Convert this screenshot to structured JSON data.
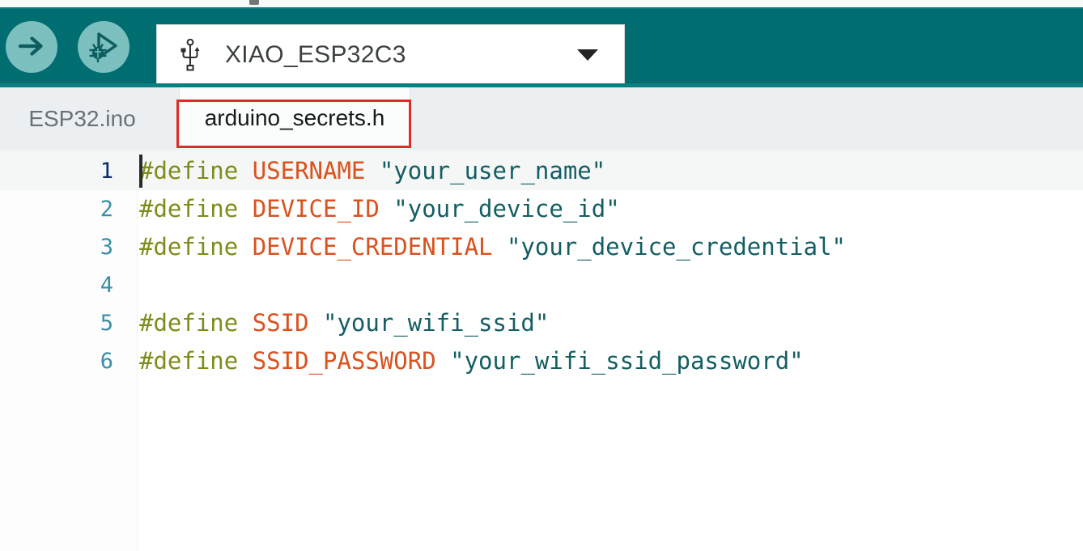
{
  "window": {
    "background_color": "#ffffff",
    "toolbar_color": "#006d70",
    "accent_color": "#7bbfbf",
    "annotation_color": "#e02b26"
  },
  "toolbar": {
    "upload_button": {
      "label": "Upload",
      "icon": "arrow-right-icon"
    },
    "debug_button": {
      "label": "Start Debugging",
      "icon": "debug-bug-play-icon"
    },
    "board_selector": {
      "icon": "usb-icon",
      "value": "XIAO_ESP32C3",
      "caret_icon": "chevron-down-icon",
      "options": [
        "XIAO_ESP32C3"
      ]
    }
  },
  "tabs": [
    {
      "label": "ESP32.ino",
      "active": false
    },
    {
      "label": "arduino_secrets.h",
      "active": true,
      "highlighted": true
    }
  ],
  "editor": {
    "language": "c",
    "cursor_line": 1,
    "cursor_column": 1,
    "colors": {
      "directive": "#7f8c1a",
      "macro": "#d9531e",
      "string": "#135e62",
      "line_number": "#3a8fa5",
      "line_number_active": "#0d2a66",
      "active_line_bg": "#f5f6f6"
    },
    "lines": [
      {
        "number": "1",
        "active": true,
        "tokens": [
          {
            "type": "directive",
            "text": "#define"
          },
          {
            "type": "plain",
            "text": " "
          },
          {
            "type": "macro",
            "text": "USERNAME"
          },
          {
            "type": "plain",
            "text": " "
          },
          {
            "type": "string",
            "text": "\"your_user_name\""
          }
        ]
      },
      {
        "number": "2",
        "active": false,
        "tokens": [
          {
            "type": "directive",
            "text": "#define"
          },
          {
            "type": "plain",
            "text": " "
          },
          {
            "type": "macro",
            "text": "DEVICE_ID"
          },
          {
            "type": "plain",
            "text": " "
          },
          {
            "type": "string",
            "text": "\"your_device_id\""
          }
        ]
      },
      {
        "number": "3",
        "active": false,
        "tokens": [
          {
            "type": "directive",
            "text": "#define"
          },
          {
            "type": "plain",
            "text": " "
          },
          {
            "type": "macro",
            "text": "DEVICE_CREDENTIAL"
          },
          {
            "type": "plain",
            "text": " "
          },
          {
            "type": "string",
            "text": "\"your_device_credential\""
          }
        ]
      },
      {
        "number": "4",
        "active": false,
        "tokens": []
      },
      {
        "number": "5",
        "active": false,
        "tokens": [
          {
            "type": "directive",
            "text": "#define"
          },
          {
            "type": "plain",
            "text": " "
          },
          {
            "type": "macro",
            "text": "SSID"
          },
          {
            "type": "plain",
            "text": " "
          },
          {
            "type": "string",
            "text": "\"your_wifi_ssid\""
          }
        ]
      },
      {
        "number": "6",
        "active": false,
        "tokens": [
          {
            "type": "directive",
            "text": "#define"
          },
          {
            "type": "plain",
            "text": " "
          },
          {
            "type": "macro",
            "text": "SSID_PASSWORD"
          },
          {
            "type": "plain",
            "text": " "
          },
          {
            "type": "string",
            "text": "\"your_wifi_ssid_password\""
          }
        ]
      }
    ]
  }
}
